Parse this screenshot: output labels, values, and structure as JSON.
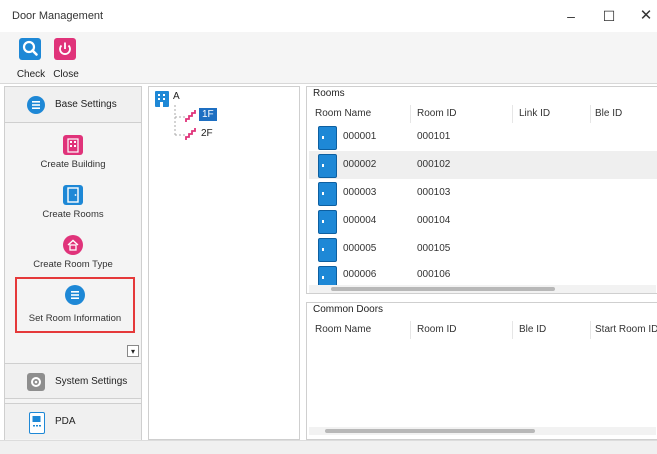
{
  "window": {
    "title": "Door Management",
    "minimize": "–",
    "maximize": "☐",
    "close": "✕"
  },
  "toolbar": {
    "check_label": "Check",
    "close_label": "Close",
    "check_color": "#1e88d6",
    "close_color": "#e0337a"
  },
  "nav": {
    "base_settings": "Base Settings",
    "items": [
      {
        "label": "Create Building",
        "icon": "building-icon",
        "color": "#e0337a"
      },
      {
        "label": "Create Rooms",
        "icon": "door-icon",
        "color": "#1e88d6"
      },
      {
        "label": "Create Room Type",
        "icon": "home-icon",
        "color": "#e0337a"
      },
      {
        "label": "Set Room Information",
        "icon": "list-icon",
        "color": "#1e88d6"
      }
    ],
    "dropdown": "▾",
    "system_settings": "System Settings",
    "pda": "PDA",
    "highlight_color": "#e5393a"
  },
  "tree": {
    "root": "A",
    "floors": [
      "1F",
      "2F"
    ]
  },
  "rooms": {
    "group_title": "Rooms",
    "columns": [
      "Room Name",
      "Room ID",
      "Link ID",
      "Ble ID"
    ],
    "rows": [
      {
        "name": "000001",
        "id": "000101"
      },
      {
        "name": "000002",
        "id": "000102"
      },
      {
        "name": "000003",
        "id": "000103"
      },
      {
        "name": "000004",
        "id": "000104"
      },
      {
        "name": "000005",
        "id": "000105"
      },
      {
        "name": "000006",
        "id": "000106"
      }
    ]
  },
  "common_doors": {
    "group_title": "Common Doors",
    "columns": [
      "Room Name",
      "Room ID",
      "Ble ID",
      "Start Room ID"
    ]
  }
}
